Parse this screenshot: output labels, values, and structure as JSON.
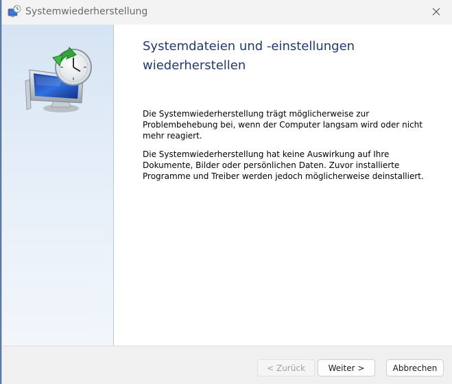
{
  "window": {
    "title": "Systemwiederherstellung",
    "app_icon": "system-restore-icon",
    "close_icon": "close-icon"
  },
  "sidebar": {
    "hero_icon": "system-restore-monitor-clock-icon"
  },
  "main": {
    "heading": "Systemdateien und -einstellungen wiederherstellen",
    "paragraph_1": "Die Systemwiederherstellung trägt möglicherweise zur Problembehebung bei, wenn der Computer langsam wird oder nicht mehr reagiert.",
    "paragraph_2": "Die Systemwiederherstellung hat keine Auswirkung auf Ihre Dokumente, Bilder oder persönlichen Daten. Zuvor installierte Programme und Treiber werden jedoch möglicherweise deinstalliert."
  },
  "footer": {
    "back_label": "< Zurück",
    "next_label": "Weiter >",
    "cancel_label": "Abbrechen",
    "back_enabled": false
  }
}
